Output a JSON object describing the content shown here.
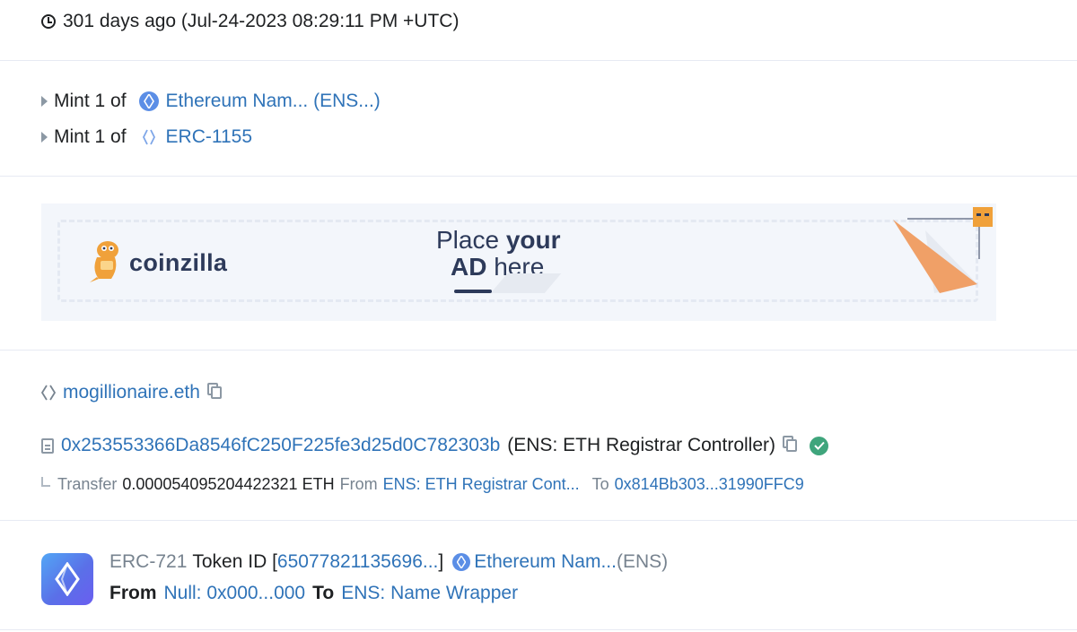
{
  "timestamp": {
    "text": "301 days ago (Jul-24-2023 08:29:11 PM +UTC)"
  },
  "mints": [
    {
      "prefix": "Mint 1 of",
      "token": "Ethereum Nam... (ENS...)"
    },
    {
      "prefix": "Mint 1 of",
      "token": "ERC-1155"
    }
  ],
  "ad": {
    "brand": "coinzilla",
    "cta_line1_a": "Place ",
    "cta_line1_b": "your",
    "cta_line2_a": "AD",
    "cta_line2_b": " here"
  },
  "ens_name": {
    "label": "mogillionaire.eth"
  },
  "contract": {
    "address": "0x253553366Da8546fC250F225fe3d25d0C782303b",
    "name": "(ENS: ETH Registrar Controller)"
  },
  "transfer": {
    "label": "Transfer",
    "amount": "0.000054095204422321 ETH",
    "from_label": "From",
    "from": "ENS: ETH Registrar Cont...",
    "to_label": "To",
    "to": "0x814Bb303...31990FFC9"
  },
  "token_transfer": {
    "standard": "ERC-721",
    "token_id_label": "Token ID [",
    "token_id": "65077821135696...",
    "token_id_close": " ]",
    "token_name": "Ethereum Nam...",
    "token_symbol": "(ENS)",
    "from_label": "From",
    "from": "Null: 0x000...000",
    "to_label": "To",
    "to": "ENS: Name Wrapper"
  },
  "colors": {
    "link": "#2f73b8",
    "muted": "#77838f",
    "success": "#3fa57c",
    "ad_bg": "#f3f6fb"
  }
}
